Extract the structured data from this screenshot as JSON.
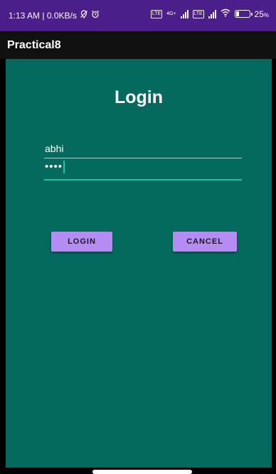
{
  "status_bar": {
    "time_data": "1:13 AM | 0.0KB/s",
    "network_label": "4G+",
    "battery_percent": "25",
    "battery_level": 0.25,
    "background_color": "#4a1f8a"
  },
  "app_bar": {
    "title": "Practical8",
    "background_color": "#111111"
  },
  "form": {
    "heading": "Login",
    "username_value": "abhi",
    "password_mask": "••••",
    "background_color": "#046a5e",
    "accent_color": "#17c7a5"
  },
  "buttons": {
    "login_label": "LOGIN",
    "cancel_label": "CANCEL",
    "button_color": "#b48cf2"
  },
  "icons": {
    "status_left": [
      "location-off-icon",
      "alarm-icon"
    ],
    "status_right": [
      "volte-icon",
      "signal-icon",
      "volte-icon",
      "signal-icon",
      "wifi-icon",
      "battery-icon"
    ]
  }
}
